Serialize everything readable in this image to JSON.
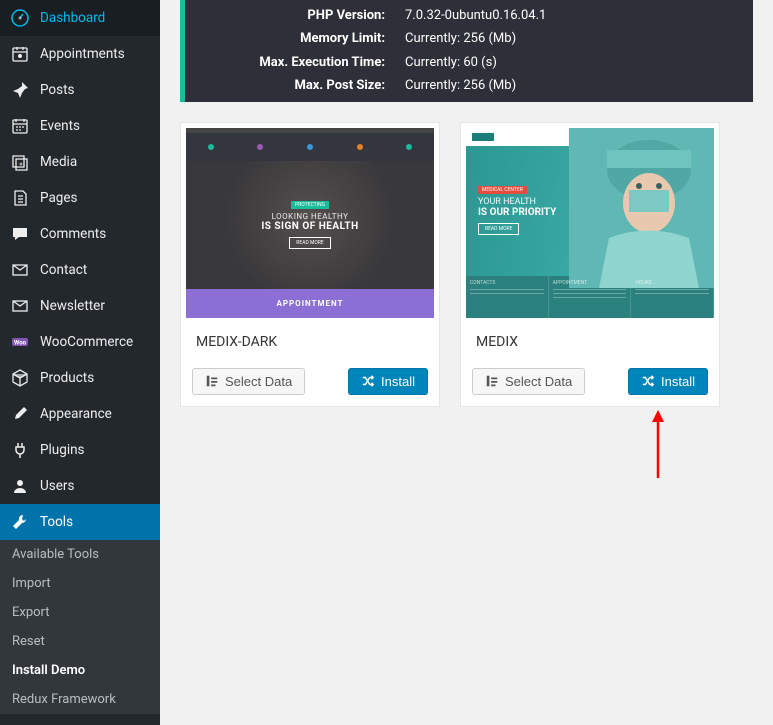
{
  "sidebar": {
    "items": [
      {
        "label": "Dashboard",
        "icon": "dashboard"
      },
      {
        "label": "Appointments",
        "icon": "calendar-alt"
      },
      {
        "label": "Posts",
        "icon": "pin"
      },
      {
        "label": "Events",
        "icon": "calendar"
      },
      {
        "label": "Media",
        "icon": "media"
      },
      {
        "label": "Pages",
        "icon": "pages"
      },
      {
        "label": "Comments",
        "icon": "comment"
      },
      {
        "label": "Contact",
        "icon": "mail"
      },
      {
        "label": "Newsletter",
        "icon": "mail"
      },
      {
        "label": "WooCommerce",
        "icon": "woo"
      },
      {
        "label": "Products",
        "icon": "package"
      },
      {
        "label": "Appearance",
        "icon": "brush"
      },
      {
        "label": "Plugins",
        "icon": "plug"
      },
      {
        "label": "Users",
        "icon": "user"
      },
      {
        "label": "Tools",
        "icon": "wrench",
        "active": true
      }
    ],
    "submenu": [
      {
        "label": "Available Tools"
      },
      {
        "label": "Import"
      },
      {
        "label": "Export"
      },
      {
        "label": "Reset"
      },
      {
        "label": "Install Demo",
        "current": true
      },
      {
        "label": "Redux Framework"
      }
    ]
  },
  "info": {
    "rows": [
      {
        "label": "PHP Version:",
        "value": "7.0.32-0ubuntu0.16.04.1"
      },
      {
        "label": "Memory Limit:",
        "value": "Currently: 256 (Mb)"
      },
      {
        "label": "Max. Execution Time:",
        "value": "Currently: 60 (s)"
      },
      {
        "label": "Max. Post Size:",
        "value": "Currently: 256 (Mb)"
      }
    ]
  },
  "demos": [
    {
      "title": "MEDIX-DARK",
      "select_label": "Select Data",
      "install_label": "Install",
      "thumb": {
        "hero_tag": "PROTECTING",
        "hero_l1": "LOOKING HEALTHY",
        "hero_l2": "IS SIGN OF HEALTH",
        "hero_btn": "READ MORE",
        "appt": "APPOINTMENT"
      }
    },
    {
      "title": "MEDIX",
      "select_label": "Select Data",
      "install_label": "Install",
      "thumb": {
        "hero_tag": "MEDICAL CENTER",
        "hero_l1": "YOUR HEALTH",
        "hero_l2": "IS OUR PRIORITY",
        "hero_btn": "READ MORE",
        "col1": "CONTACTS",
        "col2": "APPOINTMENT",
        "col3": "HOURS"
      }
    }
  ]
}
